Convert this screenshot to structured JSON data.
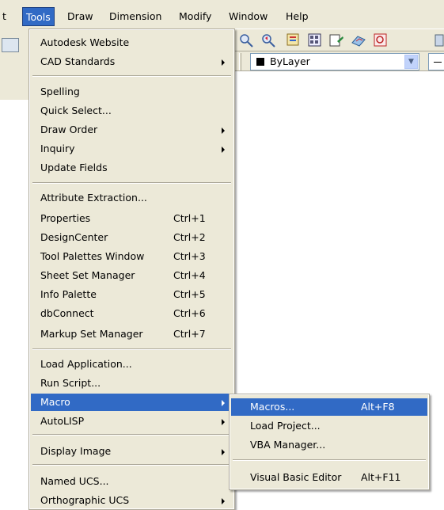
{
  "menubar": {
    "items": [
      "t",
      "Tools",
      "Draw",
      "Dimension",
      "Modify",
      "Window",
      "Help"
    ]
  },
  "layer_combo": {
    "value": "ByLayer"
  },
  "tools_menu": {
    "items": [
      {
        "label": "Autodesk Website",
        "shortcut": "",
        "submenu": false
      },
      {
        "label": "CAD Standards",
        "shortcut": "",
        "submenu": true
      },
      {
        "label": "Spelling",
        "shortcut": "",
        "submenu": false
      },
      {
        "label": "Quick Select...",
        "shortcut": "",
        "submenu": false
      },
      {
        "label": "Draw Order",
        "shortcut": "",
        "submenu": true
      },
      {
        "label": "Inquiry",
        "shortcut": "",
        "submenu": true
      },
      {
        "label": "Update Fields",
        "shortcut": "",
        "submenu": false
      },
      {
        "label": "Attribute Extraction...",
        "shortcut": "",
        "submenu": false
      },
      {
        "label": "Properties",
        "shortcut": "Ctrl+1",
        "submenu": false
      },
      {
        "label": "DesignCenter",
        "shortcut": "Ctrl+2",
        "submenu": false
      },
      {
        "label": "Tool Palettes Window",
        "shortcut": "Ctrl+3",
        "submenu": false
      },
      {
        "label": "Sheet Set Manager",
        "shortcut": "Ctrl+4",
        "submenu": false
      },
      {
        "label": "Info Palette",
        "shortcut": "Ctrl+5",
        "submenu": false
      },
      {
        "label": "dbConnect",
        "shortcut": "Ctrl+6",
        "submenu": false
      },
      {
        "label": "Markup Set Manager",
        "shortcut": "Ctrl+7",
        "submenu": false
      },
      {
        "label": "Load Application...",
        "shortcut": "",
        "submenu": false
      },
      {
        "label": "Run Script...",
        "shortcut": "",
        "submenu": false
      },
      {
        "label": "Macro",
        "shortcut": "",
        "submenu": true,
        "highlighted": true
      },
      {
        "label": "AutoLISP",
        "shortcut": "",
        "submenu": true
      },
      {
        "label": "Display Image",
        "shortcut": "",
        "submenu": true
      },
      {
        "label": "Named UCS...",
        "shortcut": "",
        "submenu": false
      },
      {
        "label": "Orthographic UCS",
        "shortcut": "",
        "submenu": true
      }
    ]
  },
  "macro_submenu": {
    "items": [
      {
        "label": "Macros...",
        "shortcut": "Alt+F8",
        "highlighted": true
      },
      {
        "label": "Load Project...",
        "shortcut": ""
      },
      {
        "label": "VBA Manager...",
        "shortcut": ""
      },
      {
        "label": "Visual Basic Editor",
        "shortcut": "Alt+F11"
      }
    ]
  },
  "colors": {
    "menu_bg": "#ece9d8",
    "highlight": "#316ac5"
  }
}
